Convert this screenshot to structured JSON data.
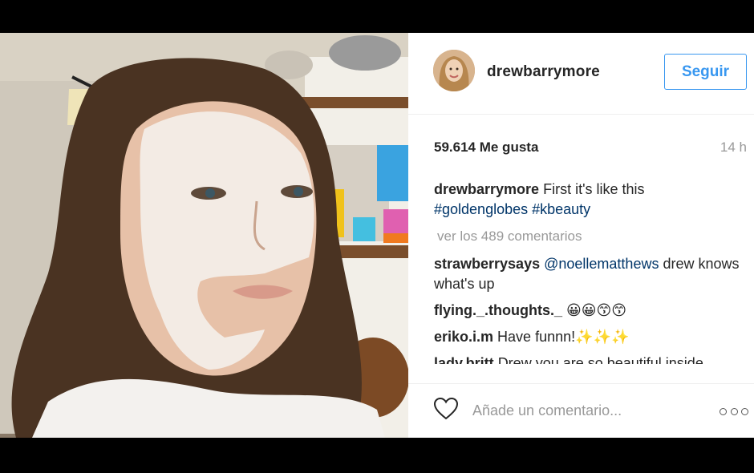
{
  "post": {
    "username": "drewbarrymore",
    "follow_label": "Seguir",
    "likes": "59.614 Me gusta",
    "time": "14 h",
    "avatar_icon": "profile-avatar",
    "caption": {
      "user": "drewbarrymore",
      "text": "First it's like this",
      "hashtags": [
        "#goldenglobes",
        "#kbeauty"
      ]
    },
    "view_more": "ver los 489 comentarios",
    "comments": [
      {
        "user": "strawberrysays",
        "mention": "@noellematthews",
        "text": "drew knows what's up"
      },
      {
        "user": "flying._.thoughts._",
        "text": "😀😀😙😙"
      },
      {
        "user": "eriko.i.m",
        "text": "Have funnn!✨✨✨"
      },
      {
        "user": "lady.britt",
        "text": "Drew you are so beautiful inside"
      }
    ],
    "comment_placeholder": "Añade un comentario...",
    "like_icon": "heart-outline",
    "options_icon": "three-dots"
  },
  "colors": {
    "accent": "#3897f0",
    "link": "#003569",
    "muted": "#999999",
    "background_bar": "#000000"
  }
}
